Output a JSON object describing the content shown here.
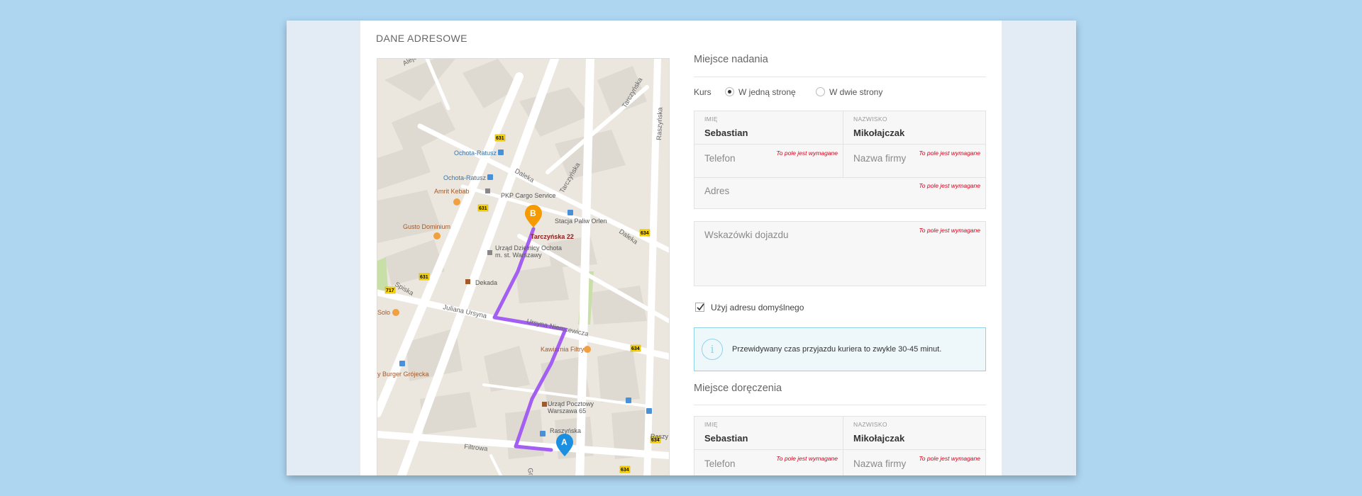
{
  "section_title": "DANE ADRESOWE",
  "colors": {
    "route": "#a35ef2",
    "marker_a": "#1d8fe1",
    "marker_b": "#f59a00",
    "required": "#d0021b",
    "info_border": "#8ed3e8"
  },
  "map": {
    "labels": {
      "aleje": "Aleje",
      "tarczynska_top": "Tarczyńska",
      "raszynska_right": "Raszyńska",
      "ochota_ratusz_1": "Ochota-Ratusz",
      "ochota_ratusz_2": "Ochota-Ratusz",
      "amrit_kebab": "Amrit Kebab",
      "pkp_cargo": "PKP Cargo Service",
      "daleka_1": "Daleka",
      "tarczynska_mid": "Tarczyńska",
      "stacja_paliw": "Stacja Paliw Orlen",
      "daleka_2": "Daleka",
      "gusto_dominium": "Gusto Dominium",
      "destination": "Tarczyńska 22",
      "urzad_dzielnicy_1": "Urząd Dzielnicy Ochota",
      "urzad_dzielnicy_2": "m. st. Warszawy",
      "spiska": "Spiska",
      "dekada": "Dekada",
      "solo": "Solo",
      "juliana_ursyna": "Juliana Ursyna",
      "niemcewicza": "Ursyna Niemcewicza",
      "kawiarnia": "Kawiarnia Filtry",
      "burger": "y Burger Grójecka",
      "urzad_pocztowy_1": "Urząd Pocztowy",
      "urzad_pocztowy_2": "Warszawa 65",
      "filtrowa": "Filtrowa",
      "raszynska_bottom": "Raszyńska",
      "raszynska_bottom_right": "Raszy",
      "grojecka_fragment": "Gro"
    },
    "road_badges": {
      "b631a": "631",
      "b631b": "631",
      "b631c": "631",
      "b634a": "634",
      "b634b": "634",
      "b634c": "634",
      "b634d": "634",
      "b717": "717"
    },
    "marker_a": "A",
    "marker_b": "B"
  },
  "origin": {
    "title": "Miejsce nadania",
    "kurs_label": "Kurs",
    "options": [
      "W jedną stronę",
      "W dwie strony"
    ],
    "selected_option": "W jedną stronę",
    "first_name_label": "IMIĘ",
    "first_name": "Sebastian",
    "last_name_label": "NAZWISKO",
    "last_name": "Mikołajczak",
    "phone_placeholder": "Telefon",
    "company_placeholder": "Nazwa firmy",
    "address_placeholder": "Adres",
    "directions_placeholder": "Wskazówki dojazdu",
    "required_msg": "To pole jest wymagane",
    "use_default_label": "Użyj adresu domyślnego",
    "use_default_checked": true,
    "info_text": "Przewidywany czas przyjazdu kuriera to zwykle 30-45 minut."
  },
  "destination": {
    "title": "Miejsce doręczenia",
    "first_name_label": "IMIĘ",
    "first_name": "Sebastian",
    "last_name_label": "NAZWISKO",
    "last_name": "Mikołajczak",
    "phone_placeholder": "Telefon",
    "company_placeholder": "Nazwa firmy",
    "required_msg": "To pole jest wymagane"
  }
}
